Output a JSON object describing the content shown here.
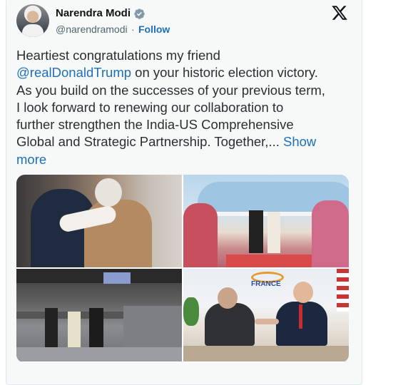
{
  "author": {
    "name": "Narendra Modi",
    "handle": "@narendramodi",
    "follow_label": "Follow",
    "separator": "·"
  },
  "icons": {
    "verified": "verified-badge-icon",
    "platform": "x-logo-icon"
  },
  "colors": {
    "link": "#1d6fb8",
    "verified": "#829aab",
    "text": "#2a2f34"
  },
  "tweet": {
    "line1": "Heartiest congratulations my friend",
    "mention": "@realDonaldTrump",
    "line2_rest": " on your historic election victory.",
    "line3": "As you build on the successes of your previous term,",
    "line4": "I look forward to renewing our collaboration to",
    "line5": "further strengthen the India-US Comprehensive",
    "line6_text": "Global and Strategic Partnership. Together,... ",
    "line6_show": "Show",
    "line7_more": "more"
  },
  "photos": [
    {
      "name": "embrace-photo"
    },
    {
      "name": "airport-welcome-photo"
    },
    {
      "name": "stadium-walk-photo"
    },
    {
      "name": "g7-handshake-photo",
      "sign_text": "FRANCE"
    }
  ]
}
